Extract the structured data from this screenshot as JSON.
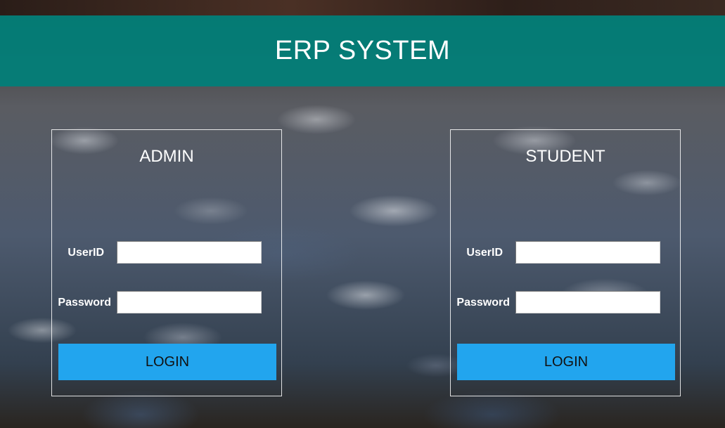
{
  "header": {
    "title": "ERP SYSTEM"
  },
  "admin": {
    "title": "ADMIN",
    "userid_label": "UserID",
    "password_label": "Password",
    "userid_value": "",
    "password_value": "",
    "login_label": "LOGIN"
  },
  "student": {
    "title": "STUDENT",
    "userid_label": "UserID",
    "password_label": "Password",
    "userid_value": "",
    "password_value": "",
    "login_label": "LOGIN"
  },
  "colors": {
    "header_bg": "#00807a",
    "button_bg": "#22a5ee",
    "text_light": "#ffffff"
  }
}
